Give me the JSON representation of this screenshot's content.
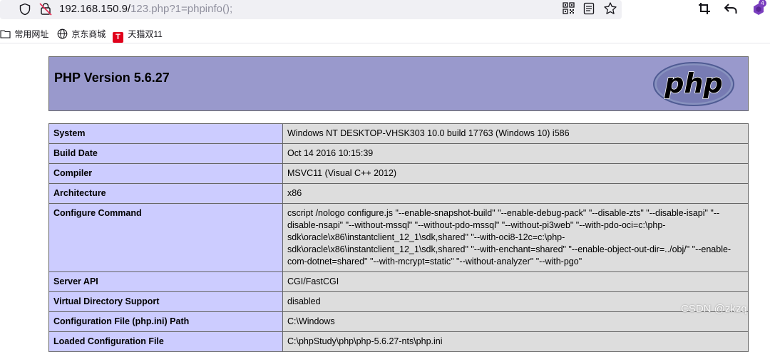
{
  "browser": {
    "url_host": "192.168.150.9/",
    "url_path": "123.php?1=phpinfo();",
    "extensions_badge": "4",
    "bookmarks": [
      {
        "icon": "folder-icon",
        "label": "常用网址"
      },
      {
        "icon": "globe-icon",
        "label": "京东商城"
      },
      {
        "icon": "tmall-icon",
        "label": "天猫双11",
        "icon_text": "T"
      }
    ]
  },
  "php": {
    "title": "PHP Version 5.6.27",
    "logo_text": "php",
    "rows": [
      {
        "key": "System",
        "value": "Windows NT DESKTOP-VHSK303 10.0 build 17763 (Windows 10) i586"
      },
      {
        "key": "Build Date",
        "value": "Oct 14 2016 10:15:39"
      },
      {
        "key": "Compiler",
        "value": "MSVC11 (Visual C++ 2012)"
      },
      {
        "key": "Architecture",
        "value": "x86"
      },
      {
        "key": "Configure Command",
        "value": "cscript /nologo configure.js \"--enable-snapshot-build\" \"--enable-debug-pack\" \"--disable-zts\" \"--disable-isapi\" \"--disable-nsapi\" \"--without-mssql\" \"--without-pdo-mssql\" \"--without-pi3web\" \"--with-pdo-oci=c:\\php-sdk\\oracle\\x86\\instantclient_12_1\\sdk,shared\" \"--with-oci8-12c=c:\\php-sdk\\oracle\\x86\\instantclient_12_1\\sdk,shared\" \"--with-enchant=shared\" \"--enable-object-out-dir=../obj/\" \"--enable-com-dotnet=shared\" \"--with-mcrypt=static\" \"--without-analyzer\" \"--with-pgo\""
      },
      {
        "key": "Server API",
        "value": "CGI/FastCGI"
      },
      {
        "key": "Virtual Directory Support",
        "value": "disabled"
      },
      {
        "key": "Configuration File (php.ini) Path",
        "value": "C:\\Windows"
      },
      {
        "key": "Loaded Configuration File",
        "value": "C:\\phpStudy\\php\\php-5.6.27-nts\\php.ini"
      }
    ]
  },
  "watermark": "CSDN @zkzq",
  "colors": {
    "header_bg": "#9999cc",
    "key_bg": "#ccccff",
    "value_bg": "#dddddd",
    "border": "#666666"
  }
}
